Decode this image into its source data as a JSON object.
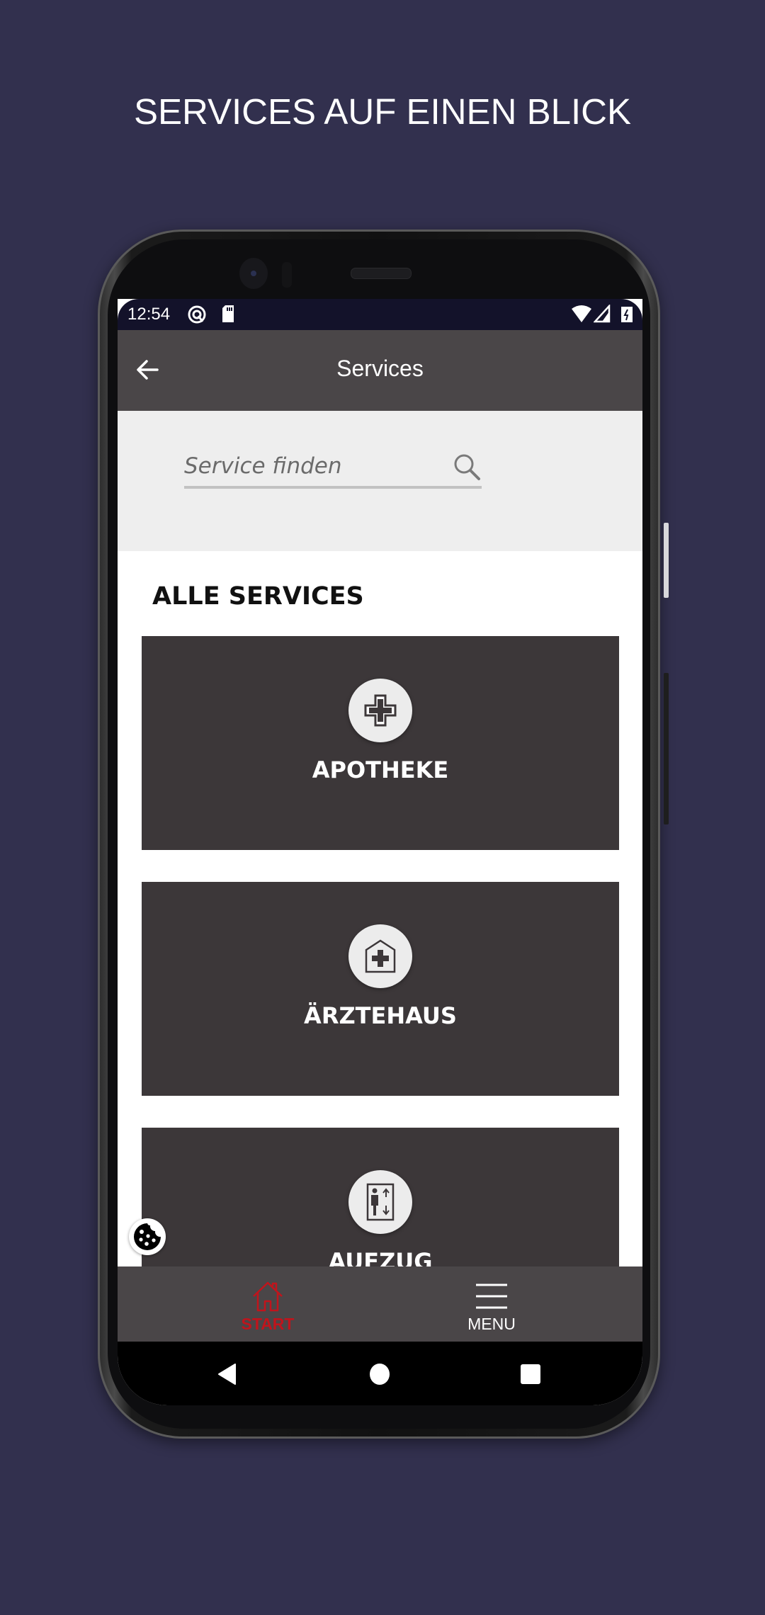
{
  "promo": {
    "title": "SERVICES AUF EINEN BLICK"
  },
  "status_bar": {
    "time": "12:54",
    "left_icons": [
      "at-sign-icon",
      "sd-card-icon"
    ],
    "right_icons": [
      "wifi-icon",
      "signal-icon",
      "battery-icon"
    ]
  },
  "app_bar": {
    "back_icon": "arrow-left-icon",
    "title": "Services"
  },
  "search": {
    "placeholder": "Service finden",
    "value": "",
    "icon": "search-icon"
  },
  "section": {
    "title": "ALLE SERVICES"
  },
  "services": [
    {
      "label": "APOTHEKE",
      "icon": "pharmacy-cross-icon"
    },
    {
      "label": "ÄRZTEHAUS",
      "icon": "medical-house-icon"
    },
    {
      "label": "AUFZUG",
      "icon": "elevator-icon"
    }
  ],
  "cookie": {
    "icon": "cookie-icon"
  },
  "bottom_nav": {
    "items": [
      {
        "label": "START",
        "icon": "home-icon",
        "active": true,
        "color": "#c0141c"
      },
      {
        "label": "MENU",
        "icon": "hamburger-menu-icon",
        "active": false,
        "color": "#ffffff"
      }
    ]
  },
  "system_nav": {
    "buttons": [
      "back-triangle-icon",
      "home-circle-icon",
      "recents-square-icon"
    ]
  },
  "colors": {
    "background": "#32304e",
    "app_bar": "#4a4648",
    "card": "#3c3739",
    "accent_active": "#c0141c",
    "status_bar": "#13122a"
  }
}
